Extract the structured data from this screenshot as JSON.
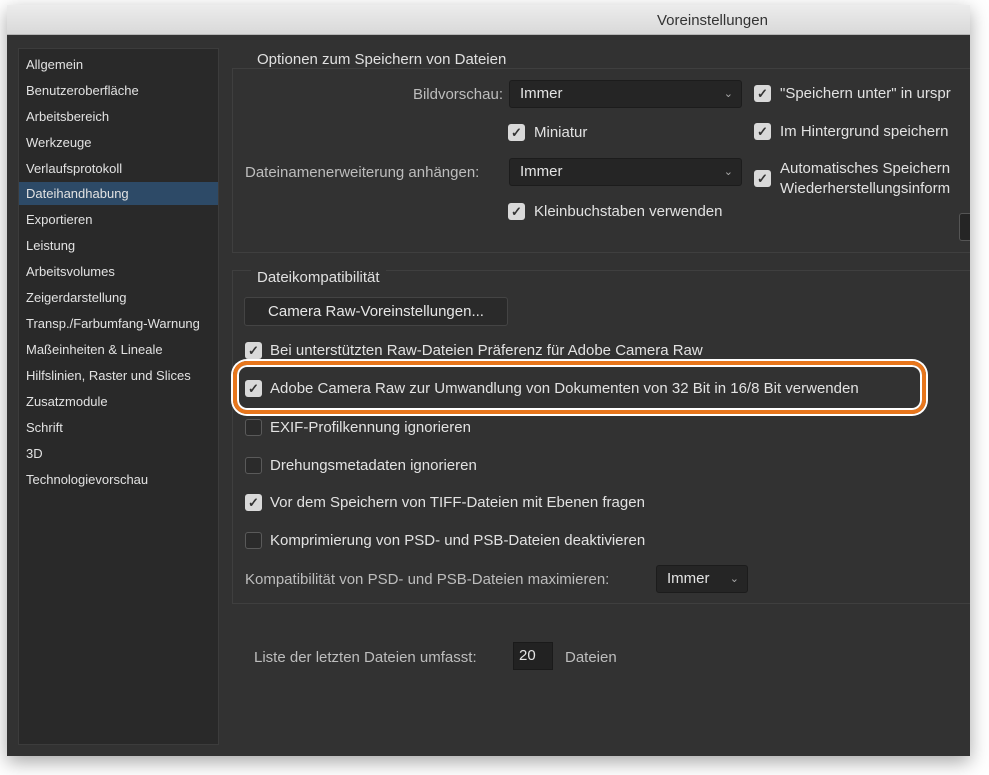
{
  "window": {
    "title": "Voreinstellungen"
  },
  "sidebar": {
    "items": [
      {
        "label": "Allgemein"
      },
      {
        "label": "Benutzeroberfläche"
      },
      {
        "label": "Arbeitsbereich"
      },
      {
        "label": "Werkzeuge"
      },
      {
        "label": "Verlaufsprotokoll"
      },
      {
        "label": "Dateihandhabung",
        "selected": true
      },
      {
        "label": "Exportieren"
      },
      {
        "label": "Leistung"
      },
      {
        "label": "Arbeitsvolumes"
      },
      {
        "label": "Zeigerdarstellung"
      },
      {
        "label": "Transp./Farbumfang-Warnung"
      },
      {
        "label": "Maßeinheiten & Lineale"
      },
      {
        "label": "Hilfslinien, Raster und Slices"
      },
      {
        "label": "Zusatzmodule"
      },
      {
        "label": "Schrift"
      },
      {
        "label": "3D"
      },
      {
        "label": "Technologievorschau"
      }
    ]
  },
  "save_options": {
    "title": "Optionen zum Speichern von Dateien",
    "preview_label": "Bildvorschau:",
    "preview_value": "Immer",
    "thumbnail": {
      "label": "Miniatur",
      "checked": true
    },
    "extension_label": "Dateinamenerweiterung anhängen:",
    "extension_value": "Immer",
    "lowercase": {
      "label": "Kleinbuchstaben verwenden",
      "checked": true
    },
    "save_as_original": {
      "label": "\"Speichern unter\" in urspr",
      "checked": true
    },
    "background_save": {
      "label": "Im Hintergrund speichern",
      "checked": true
    },
    "auto_save": {
      "label_line1": "Automatisches Speichern",
      "label_line2": "Wiederherstellungsinform",
      "checked": true
    }
  },
  "compat": {
    "title": "Dateikompatibilität",
    "camera_raw_button": "Camera Raw-Voreinstellungen...",
    "options": [
      {
        "label": "Bei unterstützten Raw-Dateien Präferenz für Adobe Camera Raw",
        "checked": true
      },
      {
        "label": "Adobe Camera Raw zur Umwandlung von Dokumenten von 32 Bit in 16/8 Bit verwenden",
        "checked": true,
        "highlighted": true
      },
      {
        "label": "EXIF-Profilkennung ignorieren",
        "checked": false
      },
      {
        "label": "Drehungsmetadaten ignorieren",
        "checked": false
      },
      {
        "label": "Vor dem Speichern von TIFF-Dateien mit Ebenen fragen",
        "checked": true
      },
      {
        "label": "Komprimierung von PSD- und PSB-Dateien deaktivieren",
        "checked": false
      }
    ],
    "maximize_label": "Kompatibilität von PSD- und PSB-Dateien maximieren:",
    "maximize_value": "Immer"
  },
  "recent": {
    "label": "Liste der letzten Dateien umfasst:",
    "value": "20",
    "suffix": "Dateien"
  },
  "colors": {
    "highlight": "#e8761c",
    "selected": "#2d4a67"
  }
}
